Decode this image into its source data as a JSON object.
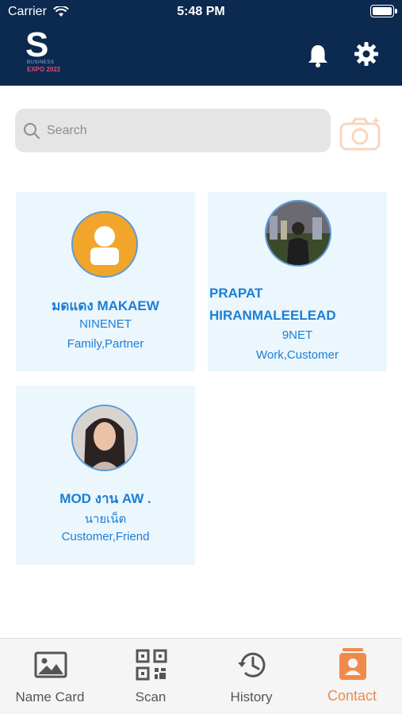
{
  "status": {
    "carrier": "Carrier",
    "time": "5:48 PM"
  },
  "header": {
    "logo_letter": "S",
    "logo_line": "BUSINESS",
    "logo_expo": "EXPO 2022"
  },
  "search": {
    "placeholder": "Search"
  },
  "contacts": [
    {
      "name": "มดแดง MAKAEW",
      "company": "NINENET",
      "tags": "Family,Partner",
      "avatar": "default-user-avatar"
    },
    {
      "name": "PRAPAT HIRANMALEELEAD",
      "company": "9NET",
      "tags": "Work,Customer",
      "avatar": "photo-avatar"
    },
    {
      "name": "MOD งาน AW .",
      "company": "นายเน็ต",
      "tags": "Customer,Friend",
      "avatar": "photo-avatar"
    }
  ],
  "tabs": [
    {
      "label": "Name Card",
      "icon": "image-icon"
    },
    {
      "label": "Scan",
      "icon": "qr-code-icon"
    },
    {
      "label": "History",
      "icon": "history-icon"
    },
    {
      "label": "Contact",
      "icon": "contact-icon",
      "active": true
    }
  ],
  "colors": {
    "header": "#0c2a4f",
    "accent": "#f08a4b",
    "link": "#1a7fd6",
    "card": "#ecf6fd"
  }
}
